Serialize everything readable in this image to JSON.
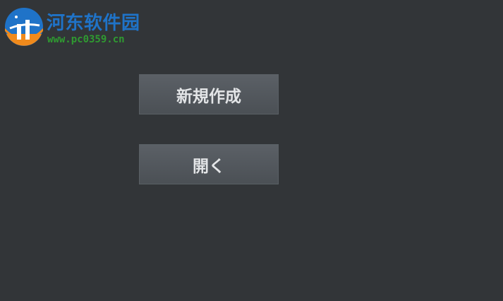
{
  "watermark": {
    "title": "河东软件园",
    "url": "www.pc0359.cn",
    "colors": {
      "title": "#1f73c8",
      "url": "#2f9a31",
      "logo_blue": "#1f73c8",
      "logo_orange": "#f08a1c"
    }
  },
  "menu": {
    "new_label": "新規作成",
    "open_label": "開く"
  },
  "theme": {
    "background": "#323538",
    "button": "#50555a",
    "button_text": "#e3e5e7"
  }
}
